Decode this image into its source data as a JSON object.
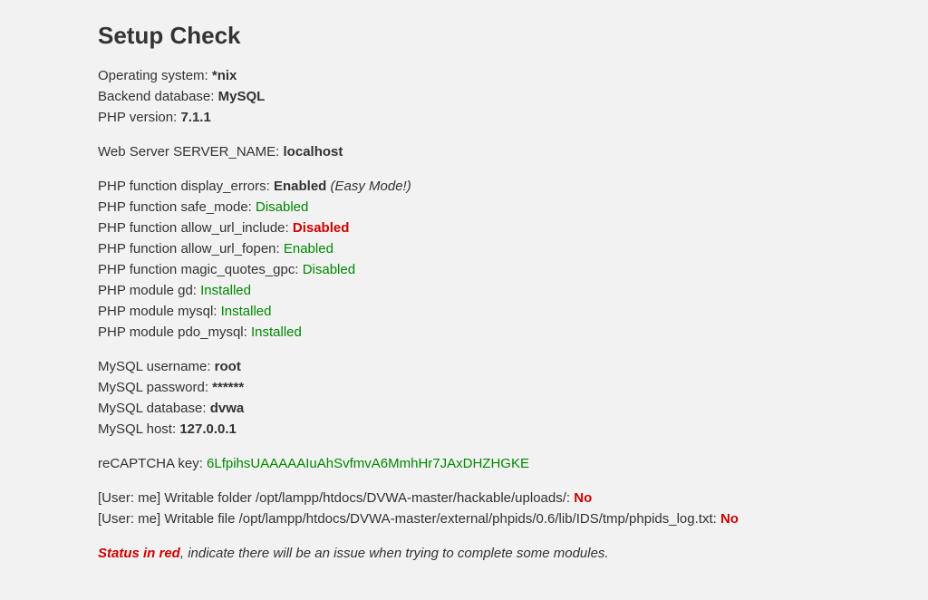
{
  "heading": "Setup Check",
  "os": {
    "label": "Operating system: ",
    "value": "*nix"
  },
  "backend": {
    "label": "Backend database: ",
    "value": "MySQL"
  },
  "php_version": {
    "label": "PHP version: ",
    "value": "7.1.1"
  },
  "server_name": {
    "label": "Web Server SERVER_NAME: ",
    "value": "localhost"
  },
  "php_display_errors": {
    "label": "PHP function display_errors: ",
    "value": "Enabled",
    "note": " (Easy Mode!)"
  },
  "php_safe_mode": {
    "label": "PHP function safe_mode: ",
    "value": "Disabled"
  },
  "php_allow_url_include": {
    "label": "PHP function allow_url_include: ",
    "value": "Disabled"
  },
  "php_allow_url_fopen": {
    "label": "PHP function allow_url_fopen: ",
    "value": "Enabled"
  },
  "php_magic_quotes": {
    "label": "PHP function magic_quotes_gpc: ",
    "value": "Disabled"
  },
  "php_mod_gd": {
    "label": "PHP module gd: ",
    "value": "Installed"
  },
  "php_mod_mysql": {
    "label": "PHP module mysql: ",
    "value": "Installed"
  },
  "php_mod_pdo_mysql": {
    "label": "PHP module pdo_mysql: ",
    "value": "Installed"
  },
  "mysql_user": {
    "label": "MySQL username: ",
    "value": "root"
  },
  "mysql_pass": {
    "label": "MySQL password: ",
    "value": "******"
  },
  "mysql_db": {
    "label": "MySQL database: ",
    "value": "dvwa"
  },
  "mysql_host": {
    "label": "MySQL host: ",
    "value": "127.0.0.1"
  },
  "recaptcha": {
    "label": "reCAPTCHA key: ",
    "value": "6LfpihsUAAAAAIuAhSvfmvA6MmhHr7JAxDHZHGKE"
  },
  "writable_folder": {
    "label": "[User: me] Writable folder /opt/lampp/htdocs/DVWA-master/hackable/uploads/: ",
    "value": "No"
  },
  "writable_file": {
    "label": "[User: me] Writable file /opt/lampp/htdocs/DVWA-master/external/phpids/0.6/lib/IDS/tmp/phpids_log.txt: ",
    "value": "No"
  },
  "status_note": {
    "prefix": "Status in red",
    "rest": ", indicate there will be an issue when trying to complete some modules."
  }
}
